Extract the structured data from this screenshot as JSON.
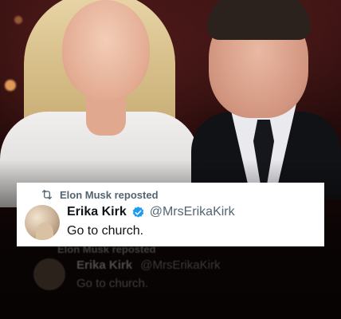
{
  "post": {
    "repost_text": "Elon Musk reposted",
    "author_name": "Erika Kirk",
    "handle": "@MrsErikaKirk",
    "body": "Go to church."
  },
  "reflection": {
    "repost_text": "Elon Musk reposted",
    "author_name": "Erika Kirk",
    "handle": "@MrsErikaKirk",
    "body": "Go to church."
  },
  "icons": {
    "repost": "repost-icon",
    "verified": "verified-badge-icon"
  },
  "colors": {
    "verified_blue": "#1d9bf0",
    "muted_text": "#536471",
    "card_bg": "#ffffff"
  }
}
